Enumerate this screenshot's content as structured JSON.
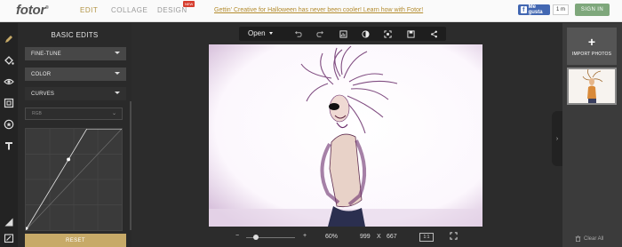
{
  "header": {
    "logo": "fotor",
    "logo_mark": "®",
    "nav": {
      "edit": "EDIT",
      "collage": "COLLAGE",
      "design": "DESIGN",
      "design_badge": "NEW"
    },
    "promo": "Gettin' Creative for Halloween has never been cooler! Learn how with Fotor!",
    "facebook": {
      "label": "Me gusta",
      "count": "1 m"
    },
    "signin": "SIGN IN"
  },
  "left_tools": [
    "pencil-icon",
    "bucket-icon",
    "eye-icon",
    "frame-icon",
    "sticker-icon",
    "text-icon",
    "tilt-shift-icon",
    "export-icon"
  ],
  "panel": {
    "title": "BASIC EDITS",
    "sections": [
      "FINE-TUNE",
      "COLOR",
      "CURVES"
    ],
    "channel": "RGB",
    "reset": "RESET"
  },
  "toolbar": {
    "open": "Open",
    "icons": [
      "undo-icon",
      "redo-icon",
      "histogram-icon",
      "compare-icon",
      "fit-icon",
      "save-icon",
      "share-icon"
    ]
  },
  "zoom": {
    "minus": "−",
    "plus": "+",
    "percent": "60%",
    "level": 0.2,
    "width": "999",
    "times": "X",
    "height": "667",
    "ratio": "1:1"
  },
  "right_panel": {
    "import": "IMPORT PHOTOS",
    "clear": "Clear All"
  },
  "colors": {
    "accent": "#c7aa68",
    "signin": "#7ea77b",
    "facebook": "#4267b2",
    "badge": "#d63d2e"
  }
}
